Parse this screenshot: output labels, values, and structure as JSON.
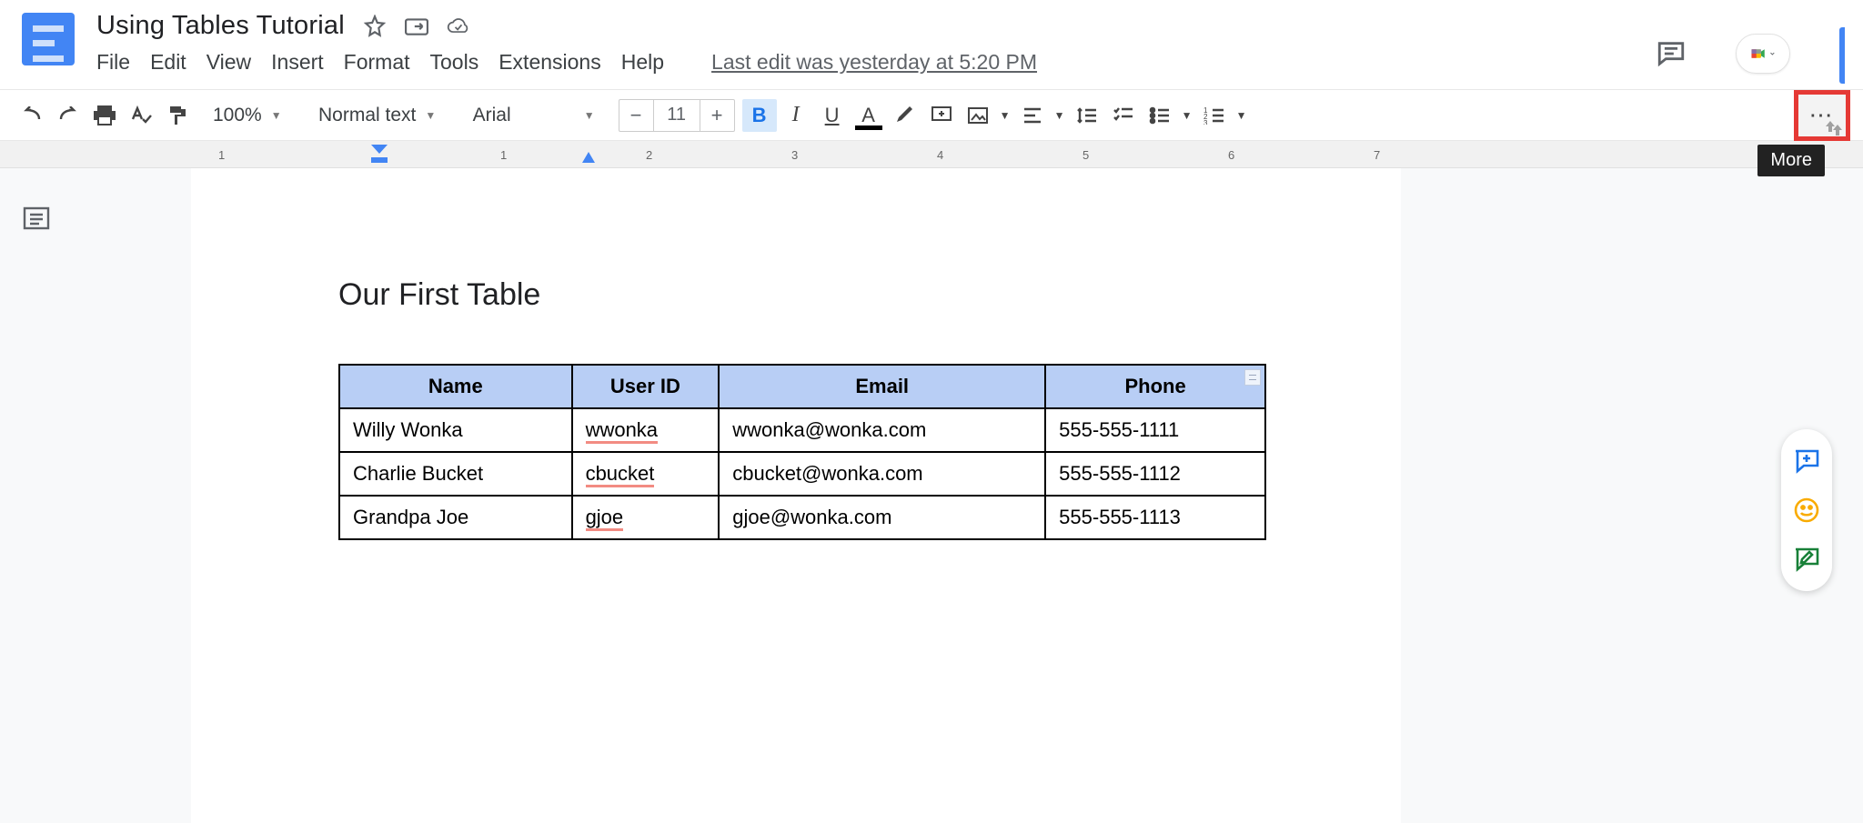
{
  "docTitle": "Using Tables Tutorial",
  "menus": {
    "file": "File",
    "edit": "Edit",
    "view": "View",
    "insert": "Insert",
    "format": "Format",
    "tools": "Tools",
    "extensions": "Extensions",
    "help": "Help"
  },
  "lastEdit": "Last edit was yesterday at 5:20 PM",
  "toolbar": {
    "zoom": "100%",
    "styleName": "Normal text",
    "fontName": "Arial",
    "fontSize": "11",
    "moreTooltip": "More"
  },
  "ruler": {
    "marks": [
      "1",
      "1",
      "2",
      "3",
      "4",
      "5",
      "6",
      "7"
    ]
  },
  "content": {
    "pageHeading": "Our First Table",
    "table": {
      "headers": [
        "Name",
        "User ID",
        "Email",
        "Phone"
      ],
      "rows": [
        {
          "name": "Willy Wonka",
          "userId": "wwonka",
          "email": "wwonka@wonka.com",
          "phone": "555-555-1111"
        },
        {
          "name": "Charlie Bucket",
          "userId": "cbucket",
          "email": "cbucket@wonka.com",
          "phone": "555-555-1112"
        },
        {
          "name": "Grandpa Joe",
          "userId": "gjoe",
          "email": "gjoe@wonka.com",
          "phone": "555-555-1113"
        }
      ]
    }
  }
}
